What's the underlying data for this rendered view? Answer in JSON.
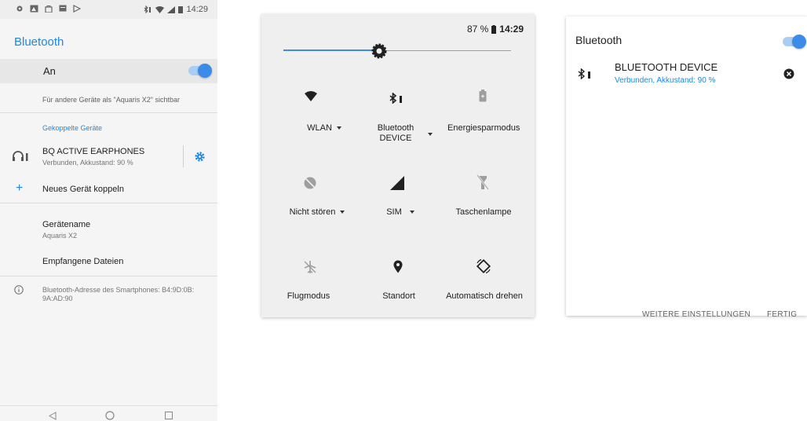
{
  "settings": {
    "status_time": "14:29",
    "title": "Bluetooth",
    "toggle_label": "An",
    "visibility_text": "Für andere Geräte als \"Aquaris X2\" sichtbar",
    "paired_header": "Gekoppelte Geräte",
    "paired_device": {
      "name": "BQ ACTIVE EARPHONES",
      "status": "Verbunden, Akkustand: 90 %"
    },
    "pair_new": "Neues Gerät koppeln",
    "device_name_label": "Gerätename",
    "device_name_value": "Aquaris X2",
    "received_files": "Empfangene Dateien",
    "address_line1": "Bluetooth-Adresse des Smartphones: B4:9D:0B:",
    "address_line2": "9A:AD:90"
  },
  "quick_settings": {
    "battery": "87 %",
    "time": "14:29",
    "brightness_level": 0.42,
    "tiles": [
      {
        "label": "WLAN",
        "icon": "wifi-icon",
        "dropdown": true
      },
      {
        "label1": "Bluetooth",
        "label2": "DEVICE",
        "icon": "bluetooth-icon",
        "dropdown": true
      },
      {
        "label": "Energiesparmodus",
        "icon": "battery-saver-icon",
        "dropdown": false
      },
      {
        "label": "Nicht stören",
        "icon": "do-not-disturb-icon",
        "dropdown": true
      },
      {
        "label": "SIM",
        "icon": "signal-icon",
        "dropdown": true
      },
      {
        "label": "Taschenlampe",
        "icon": "flashlight-off-icon",
        "dropdown": false
      },
      {
        "label": "Flugmodus",
        "icon": "airplane-icon",
        "dropdown": false
      },
      {
        "label": "Standort",
        "icon": "location-icon",
        "dropdown": false
      },
      {
        "label": "Automatisch drehen",
        "icon": "rotate-icon",
        "dropdown": false
      }
    ]
  },
  "dialog": {
    "title": "Bluetooth",
    "device_name": "BLUETOOTH DEVICE",
    "device_status": "Verbunden, Akkustand: 90 %",
    "more_settings": "WEITERE EINSTELLUNGEN",
    "done": "FERTIG"
  },
  "colors": {
    "accent": "#1e88e5",
    "toggle_track": "#a9cdf3",
    "toggle_knob": "#3b8be8"
  }
}
